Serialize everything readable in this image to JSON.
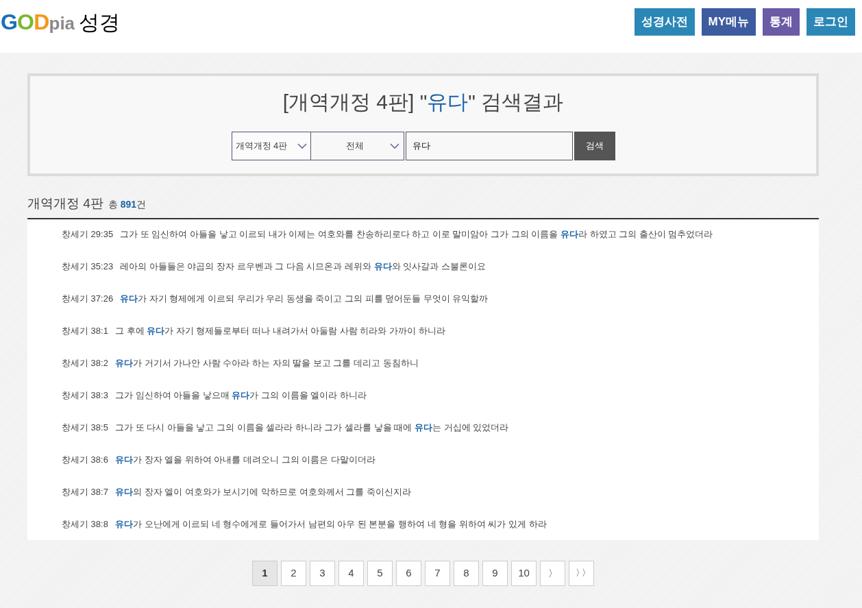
{
  "logo": {
    "letters": [
      {
        "text": "G",
        "color": "#1b6fb8"
      },
      {
        "text": "O",
        "color": "#7cb82f"
      },
      {
        "text": "D",
        "color": "#f29a1a"
      },
      {
        "text": "pia",
        "color": "#8a8a8a"
      }
    ],
    "suffix": "성경"
  },
  "nav": [
    {
      "label": "성경사전",
      "color": "#2b87b6"
    },
    {
      "label": "MY메뉴",
      "color": "#3d5b9f"
    },
    {
      "label": "통계",
      "color": "#6b5aa6"
    },
    {
      "label": "로그인",
      "color": "#2b87b6"
    }
  ],
  "search": {
    "title": [
      {
        "text": "[개역개정 4판] \"",
        "highlight": false
      },
      {
        "text": "유다",
        "highlight": true
      },
      {
        "text": "\" 검색결과",
        "highlight": false
      }
    ],
    "version_select": "개역개정 4판",
    "scope_select": "전체",
    "query": "유다",
    "button": "검색"
  },
  "results": {
    "heading": "개역개정 4판",
    "total_prefix": "총",
    "total": "891",
    "total_suffix": "건",
    "rows": [
      {
        "ref": "창세기 29:35",
        "parts": [
          {
            "text": "그가 또 임신하여 아들을 낳고 이르되 내가 이제는 여호와를 찬송하리로다 하고 이로 말미암아 그가 그의 이름을 ",
            "highlight": false
          },
          {
            "text": "유다",
            "highlight": true
          },
          {
            "text": "라 하였고 그의 출산이 멈추었더라",
            "highlight": false
          }
        ]
      },
      {
        "ref": "창세기 35:23",
        "parts": [
          {
            "text": "레아의 아들들은 야곱의 장자 르우벤과 그 다음 시므온과 레위와 ",
            "highlight": false
          },
          {
            "text": "유다",
            "highlight": true
          },
          {
            "text": "와 잇사갈과 스불론이요",
            "highlight": false
          }
        ]
      },
      {
        "ref": "창세기 37:26",
        "parts": [
          {
            "text": "유다",
            "highlight": true
          },
          {
            "text": "가 자기 형제에게 이르되 우리가 우리 동생을 죽이고 그의 피를 덮어둔들 무엇이 유익할까",
            "highlight": false
          }
        ]
      },
      {
        "ref": "창세기 38:1",
        "parts": [
          {
            "text": "그 후에 ",
            "highlight": false
          },
          {
            "text": "유다",
            "highlight": true
          },
          {
            "text": "가 자기 형제들로부터 떠나 내려가서 아둘람 사람 히라와 가까이 하니라",
            "highlight": false
          }
        ]
      },
      {
        "ref": "창세기 38:2",
        "parts": [
          {
            "text": "유다",
            "highlight": true
          },
          {
            "text": "가 거기서 가나안 사람 수아라 하는 자의 딸을 보고 그를 데리고 동침하니",
            "highlight": false
          }
        ]
      },
      {
        "ref": "창세기 38:3",
        "parts": [
          {
            "text": "그가 임신하여 아들을 낳으매 ",
            "highlight": false
          },
          {
            "text": "유다",
            "highlight": true
          },
          {
            "text": "가 그의 이름을 엘이라 하니라",
            "highlight": false
          }
        ]
      },
      {
        "ref": "창세기 38:5",
        "parts": [
          {
            "text": "그가 또 다시 아들을 낳고 그의 이름을 셀라라 하니라 그가 셀라를 낳을 때에 ",
            "highlight": false
          },
          {
            "text": "유다",
            "highlight": true
          },
          {
            "text": "는 거십에 있었더라",
            "highlight": false
          }
        ]
      },
      {
        "ref": "창세기 38:6",
        "parts": [
          {
            "text": "유다",
            "highlight": true
          },
          {
            "text": "가 장자 엘을 위하여 아내를 데려오니 그의 이름은 다말이더라",
            "highlight": false
          }
        ]
      },
      {
        "ref": "창세기 38:7",
        "parts": [
          {
            "text": "유다",
            "highlight": true
          },
          {
            "text": "의 장자 엘이 여호와가 보시기에 악하므로 여호와께서 그를 죽이신지라",
            "highlight": false
          }
        ]
      },
      {
        "ref": "창세기 38:8",
        "parts": [
          {
            "text": "유다",
            "highlight": true
          },
          {
            "text": "가 오난에게 이르되 네 형수에게로 들어가서 남편의 아우 된 본분을 행하여 네 형을 위하여 씨가 있게 하라",
            "highlight": false
          }
        ]
      }
    ]
  },
  "pagination": {
    "pages": [
      {
        "label": "1",
        "selected": true
      },
      {
        "label": "2",
        "selected": false
      },
      {
        "label": "3",
        "selected": false
      },
      {
        "label": "4",
        "selected": false
      },
      {
        "label": "5",
        "selected": false
      },
      {
        "label": "6",
        "selected": false
      },
      {
        "label": "7",
        "selected": false
      },
      {
        "label": "8",
        "selected": false
      },
      {
        "label": "9",
        "selected": false
      },
      {
        "label": "10",
        "selected": false
      }
    ],
    "next": "〉",
    "last": "〉〉"
  }
}
